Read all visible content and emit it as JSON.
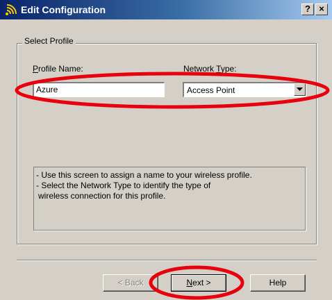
{
  "window": {
    "title": "Edit Configuration",
    "icon": "wireless-signal-icon",
    "help_button": "?",
    "close_button": "×"
  },
  "group": {
    "label": "Select Profile"
  },
  "profile_name": {
    "label": "Profile Name:",
    "value": "Azure"
  },
  "network_type": {
    "label": "Network Type:",
    "value": "Access Point"
  },
  "info": {
    "lines": [
      "- Use this screen to assign a name to your wireless profile.",
      "- Select the Network Type to identify the type of",
      "  wireless connection for this profile."
    ]
  },
  "buttons": {
    "back": "< Back",
    "next": "Next >",
    "help": "Help"
  },
  "colors": {
    "annotation": "#e8000d",
    "title_bar": "#0a246a",
    "dialog_bg": "#d4d0c8"
  }
}
